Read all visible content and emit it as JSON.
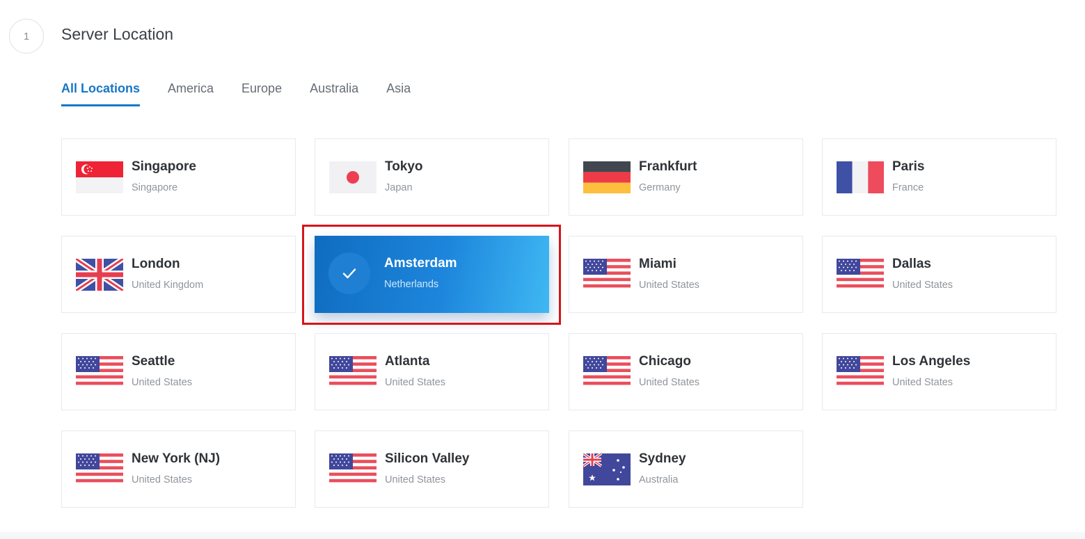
{
  "step": {
    "number": "1",
    "title": "Server Location"
  },
  "tabs": [
    "All Locations",
    "America",
    "Europe",
    "Australia",
    "Asia"
  ],
  "active_tab": "All Locations",
  "locations": [
    {
      "city": "Singapore",
      "country": "Singapore",
      "flag": "singapore-flag"
    },
    {
      "city": "Tokyo",
      "country": "Japan",
      "flag": "japan-flag"
    },
    {
      "city": "Frankfurt",
      "country": "Germany",
      "flag": "germany-flag"
    },
    {
      "city": "Paris",
      "country": "France",
      "flag": "france-flag"
    },
    {
      "city": "London",
      "country": "United Kingdom",
      "flag": "uk-flag"
    },
    {
      "city": "Amsterdam",
      "country": "Netherlands",
      "flag": "check-icon",
      "selected": true
    },
    {
      "city": "Miami",
      "country": "United States",
      "flag": "us-flag"
    },
    {
      "city": "Dallas",
      "country": "United States",
      "flag": "us-flag"
    },
    {
      "city": "Seattle",
      "country": "United States",
      "flag": "us-flag"
    },
    {
      "city": "Atlanta",
      "country": "United States",
      "flag": "us-flag"
    },
    {
      "city": "Chicago",
      "country": "United States",
      "flag": "us-flag"
    },
    {
      "city": "Los Angeles",
      "country": "United States",
      "flag": "us-flag"
    },
    {
      "city": "New York (NJ)",
      "country": "United States",
      "flag": "us-flag"
    },
    {
      "city": "Silicon Valley",
      "country": "United States",
      "flag": "us-flag"
    },
    {
      "city": "Sydney",
      "country": "Australia",
      "flag": "australia-flag"
    }
  ],
  "colors": {
    "accent": "#1577c6",
    "selected_gradient_start": "#0f6cc0",
    "selected_gradient_end": "#3fb8f3",
    "highlight_border": "#d7141a"
  }
}
